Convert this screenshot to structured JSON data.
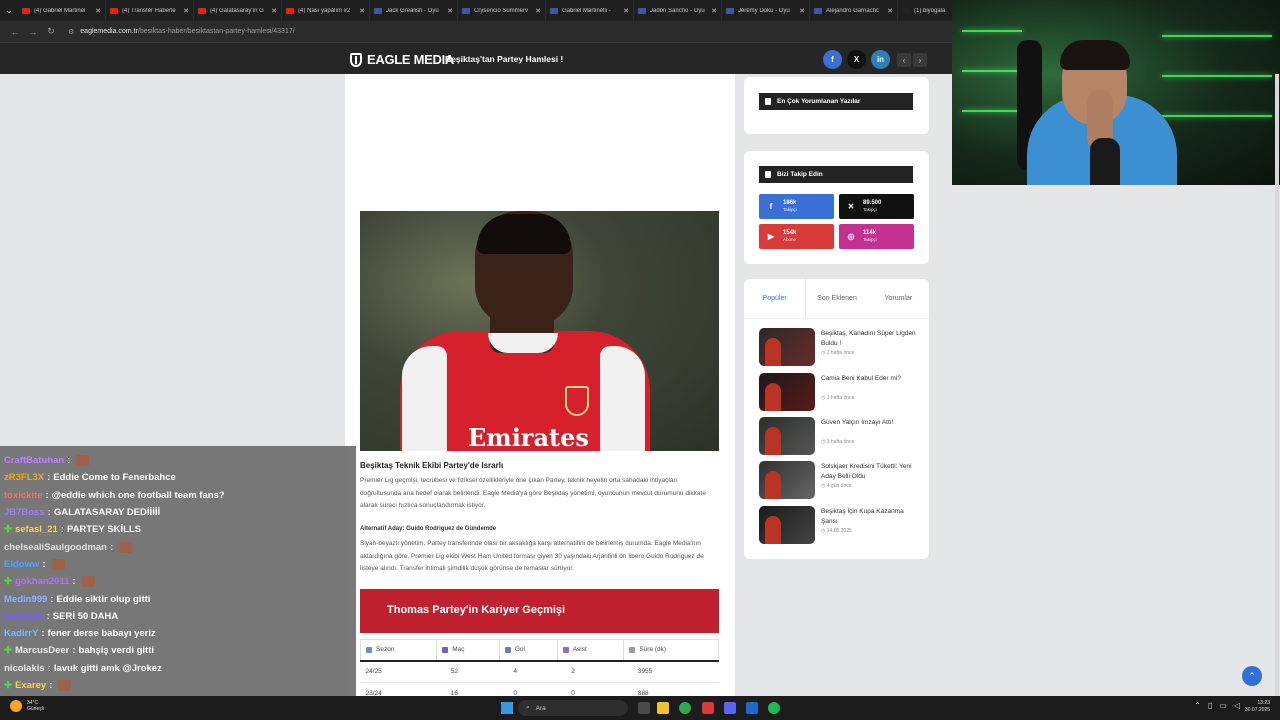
{
  "browser": {
    "tabs": [
      {
        "title": "(4) Gabriel Martinel",
        "icon": "youtube"
      },
      {
        "title": "(4) Transfer Haberle",
        "icon": "youtube"
      },
      {
        "title": "(4) Galatasaray'ın G",
        "icon": "youtube"
      },
      {
        "title": "(4) Nası yapalım #2",
        "icon": "youtube"
      },
      {
        "title": "Jack Grealish - Oyu",
        "icon": "site"
      },
      {
        "title": "Crysencio Summerv",
        "icon": "site"
      },
      {
        "title": "Gabriel Martinelli -",
        "icon": "site"
      },
      {
        "title": "Jadon Sancho - Oyu",
        "icon": "site"
      },
      {
        "title": "Jérémy Doku - Oyu",
        "icon": "site"
      },
      {
        "title": "Alejandro Garnachc",
        "icon": "site"
      },
      {
        "title": "(1) biyogala",
        "icon": "x"
      }
    ],
    "url_domain": "eaglemedia.com.tr",
    "url_path": "/besiktas-haber/besiktastan-partey-hamlesi/43317/"
  },
  "site": {
    "logo": "EAGLE MEDIA",
    "header_title": "Beşiktaş'tan Partey Hamlesi !",
    "social": {
      "facebook": "f",
      "x": "X",
      "linkedin": "in"
    }
  },
  "article": {
    "hero_sponsor": "Emirates",
    "heading": "Beşiktaş Teknik Ekibi Partey'de Israrlı",
    "p1": "Premier Lig geçmişi, tecrübesi ve fiziksel özellikleriyle öne çıkan Partey, teknik heyetin orta sahadaki ihtiyaçları doğrultusunda ana hedef olarak belirlendi. Eagle Media'ya göre Beşiktaş yönetimi, oyuncunun mevcut durumunu dikkate alarak süreci hızlıca sonuçlandırmak istiyor.",
    "subheading": "Alternatif Aday: Guido Rodriguez de Gündemde",
    "p2": "Siyah-beyazlı yönetim, Partey transferinde olası bir aksaklığa karşı alternatifini de belirlemiş durumda. Eagle Media'nın aktardığına göre, Premier Lig ekibi West Ham United forması giyen 30 yaşındaki Arjantinli ön libero Guido Rodriguez de listeye alındı. Transfer ihtimali şimdilik düşük görünse de temaslar sürüyor.",
    "career_title": "Thomas Partey'in Kariyer Geçmişi",
    "table_headers": [
      "Sezon",
      "Maç",
      "Gol",
      "Asist",
      "Süre (dk)"
    ],
    "table_rows": [
      [
        "24/25",
        "52",
        "4",
        "2",
        "3955"
      ],
      [
        "23/24",
        "16",
        "0",
        "0",
        "888"
      ]
    ]
  },
  "sidebar": {
    "most_commented_title": "En Çok Yorumlanan Yazılar",
    "follow_title": "Bizi Takip Edin",
    "follow": [
      {
        "count": "186k",
        "label": "Takipçi",
        "icon": "facebook-icon",
        "color": "#3b6fd6"
      },
      {
        "count": "89.500",
        "label": "Takipçi",
        "icon": "x-icon",
        "color": "#111111"
      },
      {
        "count": "154k",
        "label": "Abone",
        "icon": "youtube-icon",
        "color": "#d93b3b"
      },
      {
        "count": "114k",
        "label": "Takipçi",
        "icon": "instagram-icon",
        "color": "#c53191"
      }
    ],
    "tabs": [
      "Popüler",
      "Son Eklenen",
      "Yorumlar"
    ],
    "popular": [
      {
        "title": "Beşiktaş, Kanadını Süper Ligden Buldu !",
        "date": "2 hafta önce"
      },
      {
        "title": "Camia Beni Kabul Eder mi?",
        "date": "1 hafta önce"
      },
      {
        "title": "Güven Yalçın İmzayı Attı!",
        "date": "3 hafta önce"
      },
      {
        "title": "Solskjaer Kredisini Tüketti: Yeni Aday Belli Oldu",
        "date": "4 gün önce"
      },
      {
        "title": "Beşiktaş İçin Kupa Kazanma Şansı",
        "date": "14.05.2025"
      }
    ]
  },
  "chat": [
    {
      "user": "CraftBatuhan",
      "text": "",
      "plus": false,
      "emote": true,
      "color": "#c77dff"
    },
    {
      "user": "zR3FL3X",
      "text": "Eddie Come to Fenerbahce",
      "plus": false,
      "emote": false,
      "color": "#f5a623"
    },
    {
      "user": "toxickite",
      "text": "@eddie which one football team fans?",
      "plus": false,
      "emote": false,
      "color": "#ff6b6b"
    },
    {
      "user": "JB7Boss",
      "text": "GALATASARAY DEDİİİİİ",
      "plus": false,
      "emote": false,
      "color": "#9d7bff"
    },
    {
      "user": "sefasl_21",
      "text": "PARTEY SKİLLS",
      "plus": true,
      "emote": false,
      "color": "#ffd23f"
    },
    {
      "user": "chelsealiSaulgoodman",
      "text": "",
      "plus": false,
      "emote": true,
      "color": "#e0e0e0"
    },
    {
      "user": "Eldoww",
      "text": "",
      "plus": false,
      "emote": true,
      "color": "#4aa3ff"
    },
    {
      "user": "gokhan2011",
      "text": "",
      "plus": true,
      "emote": true,
      "color": "#b86bff"
    },
    {
      "user": "Medin999",
      "text": "Eddie siktir olup gitti",
      "plus": false,
      "emote": false,
      "color": "#8ab4ff"
    },
    {
      "user": "maruulls",
      "text": "SERİ 50 DAHA",
      "plus": false,
      "emote": false,
      "color": "#7a5cff"
    },
    {
      "user": "KadirrY",
      "text": "fener derse babayı yeriz",
      "plus": false,
      "emote": false,
      "color": "#7ab8ff"
    },
    {
      "user": "MarcusDeer",
      "text": "bahşiş verdi gitti",
      "plus": true,
      "emote": false,
      "color": "#e8e8e8"
    },
    {
      "user": "nicolakis",
      "text": "lavuk gitti amk @Jrokez",
      "plus": false,
      "emote": false,
      "color": "#e8e8e8"
    },
    {
      "user": "Exarey",
      "text": "",
      "plus": true,
      "emote": true,
      "color": "#ffd23f"
    }
  ],
  "taskbar": {
    "temperature": "34°C",
    "weather": "Güneşli",
    "search": "Ara",
    "time": "13:23",
    "date": "30.07.2025"
  }
}
